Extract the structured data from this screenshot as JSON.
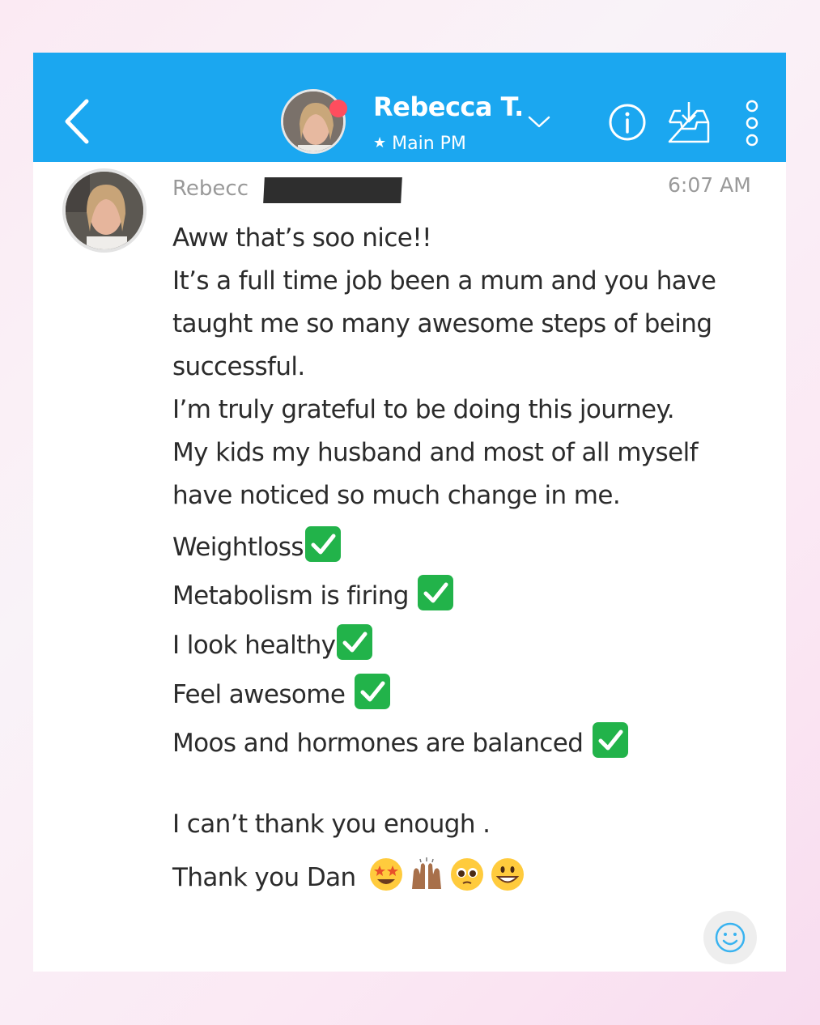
{
  "header": {
    "back_icon": "chevron-left-icon",
    "contact_name": "Rebecca T.",
    "contact_subtitle": "Main PM",
    "subtitle_icon": "star-icon",
    "chevron_icon": "chevron-down-icon",
    "info_icon": "info-icon",
    "save_icon": "inbox-download-icon",
    "more_icon": "more-vertical-icon",
    "status_color": "#ff4d5e",
    "bar_color": "#1ba7f0"
  },
  "message": {
    "sender_visible": "Rebecc",
    "timestamp": "6:07 AM",
    "lines": [
      "Aww that’s soo nice!!",
      "It’s a full time job been a mum and you have",
      "taught me so many awesome steps of being",
      "successful.",
      "I’m truly grateful to be doing this journey.",
      "My kids my husband and most of all myself",
      "have noticed so much change in me."
    ],
    "checklist": [
      "Weightloss",
      "Metabolism is firing ",
      "I look healthy",
      "Feel awesome ",
      "Moos and hormones are balanced "
    ],
    "closing": [
      "I can’t thank you enough .",
      "Thank you Dan "
    ],
    "emojis": [
      "star-struck-emoji",
      "raising-hands-emoji",
      "pleading-face-emoji",
      "grinning-face-emoji"
    ],
    "check_icon": "check-mark-button-emoji"
  },
  "reaction_button_icon": "smiley-icon"
}
